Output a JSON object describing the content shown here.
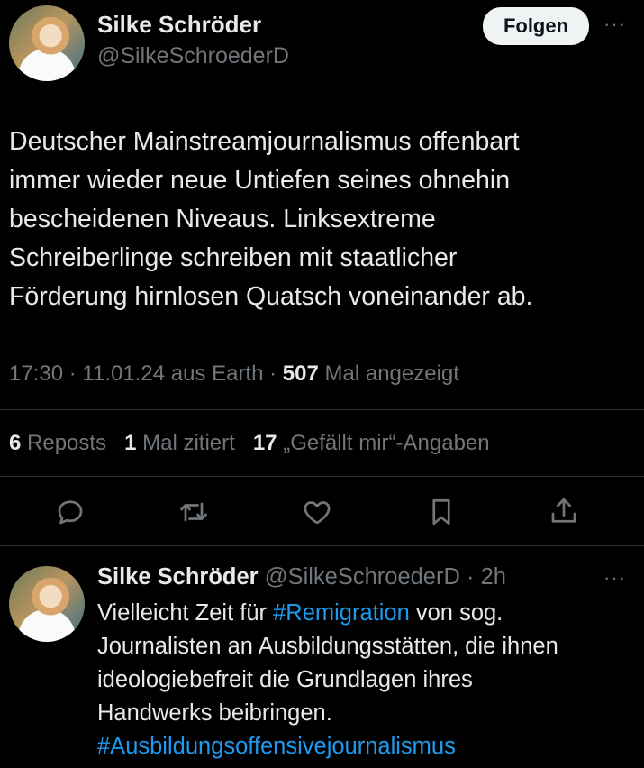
{
  "tweet": {
    "author_name": "Silke Schröder",
    "author_handle": "@SilkeSchroederD",
    "follow_label": "Folgen",
    "more_label": "···",
    "text_lines": [
      "Deutscher Mainstreamjournalismus offenbart",
      "immer wieder neue Untiefen seines ohnehin",
      "bescheidenen Niveaus. Linksextreme",
      "Schreiberlinge schreiben mit staatlicher",
      "Förderung hirnlosen Quatsch voneinander ab."
    ],
    "time": "17:30",
    "date": "11.01.24",
    "source": "aus Earth",
    "views_count": "507",
    "views_label": "Mal angezeigt",
    "reposts_count": "6",
    "reposts_label": "Reposts",
    "quotes_count": "1",
    "quotes_label": "Mal zitiert",
    "likes_count": "17",
    "likes_label": "„Gefällt mir“-Angaben"
  },
  "actions": {
    "icons": [
      "reply-icon",
      "repost-icon",
      "like-icon",
      "bookmark-icon",
      "share-icon"
    ]
  },
  "reply": {
    "author_name": "Silke Schröder",
    "author_handle": "@SilkeSchroederD",
    "age": "2h",
    "more_label": "···",
    "line1_prefix": "Vielleicht Zeit für ",
    "line1_hashtag": "#Remigration",
    "line1_suffix": " von sog.",
    "line2": "Journalisten an Ausbildungsstätten, die ihnen",
    "line3": "ideologiebefreit die Grundlagen ihres",
    "line4": "Handwerks beibringen.",
    "hashtag2": "#Ausbildungsoffensivejournalismus"
  },
  "colors": {
    "background": "#000000",
    "text": "#e7e9ea",
    "muted": "#71767b",
    "link": "#1d9bf0",
    "divider": "#2f3336"
  }
}
